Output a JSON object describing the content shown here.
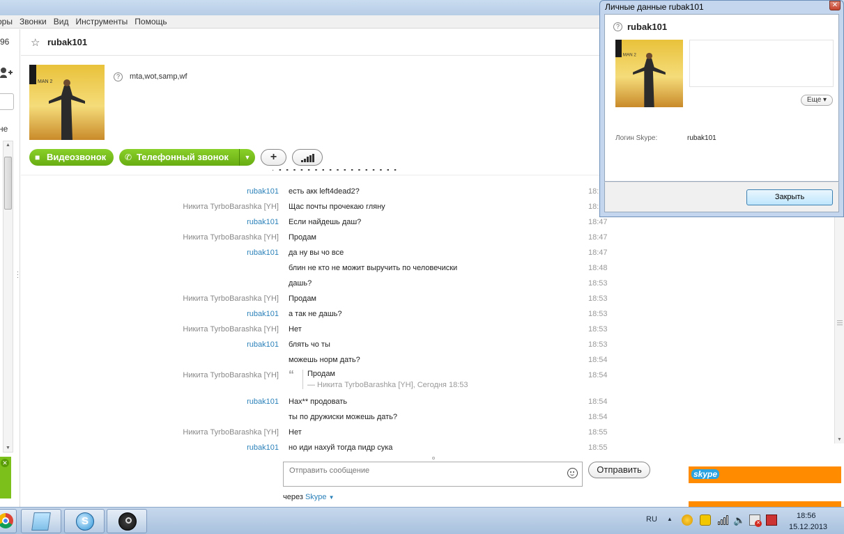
{
  "menu": [
    "оры",
    "Звонки",
    "Вид",
    "Инструменты",
    "Помощь"
  ],
  "left": {
    "count": "96",
    "tab": "не"
  },
  "header": {
    "title": "rubak101"
  },
  "profile": {
    "mood": "mta,wot,samp,wf",
    "video_call": "Видеозвонок",
    "phone_call": "Телефонный звонок"
  },
  "messages": [
    {
      "author": "rubak101",
      "me": true,
      "text": "есть акк left4dead2?",
      "time": "18:"
    },
    {
      "author": "Никита TyrboBarashka [YH]",
      "me": false,
      "text": "Щас почты прочекаю гляну",
      "time": "18:"
    },
    {
      "author": "rubak101",
      "me": true,
      "text": "Если найдешь даш?",
      "time": "18:47"
    },
    {
      "author": "Никита TyrboBarashka [YH]",
      "me": false,
      "text": "Продам",
      "time": "18:47"
    },
    {
      "author": "rubak101",
      "me": true,
      "text": "да ну вы чо все",
      "time": "18:47"
    },
    {
      "author": "",
      "me": true,
      "text": "блин не кто не можит выручить по человечиски",
      "time": "18:48"
    },
    {
      "author": "",
      "me": true,
      "text": "дашь?",
      "time": "18:53"
    },
    {
      "author": "Никита TyrboBarashka [YH]",
      "me": false,
      "text": "Продам",
      "time": "18:53"
    },
    {
      "author": "rubak101",
      "me": true,
      "text": "а так не дашь?",
      "time": "18:53"
    },
    {
      "author": "Никита TyrboBarashka [YH]",
      "me": false,
      "text": "Нет",
      "time": "18:53"
    },
    {
      "author": "rubak101",
      "me": true,
      "text": "блять чо ты",
      "time": "18:53"
    },
    {
      "author": "",
      "me": true,
      "text": "можешь норм дать?",
      "time": "18:54"
    },
    {
      "author": "Никита TyrboBarashka [YH]",
      "me": false,
      "quote": true,
      "text": "Продам",
      "source": "— Никита TyrboBarashka [YH], Сегодня 18:53",
      "time": "18:54"
    },
    {
      "author": "rubak101",
      "me": true,
      "text": "Нах** продовать",
      "time": "18:54"
    },
    {
      "author": "",
      "me": true,
      "text": "ты по дружиски можешь дать?",
      "time": "18:54"
    },
    {
      "author": "Никита TyrboBarashka [YH]",
      "me": false,
      "text": "Нет",
      "time": "18:55"
    },
    {
      "author": "rubak101",
      "me": true,
      "text": "но иди нахуй тогда пидр сука",
      "time": "18:55"
    }
  ],
  "input": {
    "placeholder": "Отправить сообщение",
    "send": "Отправить"
  },
  "via": {
    "prefix": "через",
    "service": "Skype"
  },
  "ad": {
    "logo": "skype"
  },
  "dialog": {
    "title": "Личные данные rubak101",
    "name": "rubak101",
    "more": "Еще",
    "login_label": "Логин Skype:",
    "login_value": "rubak101",
    "close": "Закрыть"
  },
  "taskbar": {
    "lang": "RU",
    "time": "18:56",
    "date": "15.12.2013"
  },
  "colors": {
    "green": "#7cc11b",
    "link": "#2a80b9",
    "skype_orange": "#ff8c00"
  }
}
